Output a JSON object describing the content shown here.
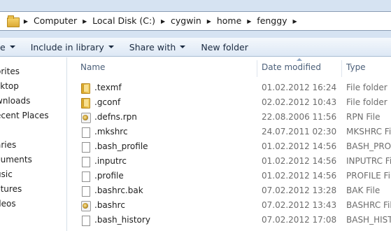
{
  "address_bar": {
    "crumbs": [
      "Computer",
      "Local Disk (C:)",
      "cygwin",
      "home",
      "fenggy"
    ],
    "separator_icon": "triangle-right-icon",
    "folder_icon": "folder-icon"
  },
  "toolbar": {
    "organize_partial": "e",
    "include_in_library": "Include in library",
    "share_with": "Share with",
    "new_folder": "New folder"
  },
  "nav": {
    "items": [
      "orites",
      "sktop",
      "wnloads",
      "ecent Places",
      "aries",
      "cuments",
      "usic",
      "ctures",
      "deos"
    ]
  },
  "columns": {
    "name": "Name",
    "date_modified": "Date modified",
    "type": "Type"
  },
  "files": [
    {
      "name": ".texmf",
      "date": "01.02.2012 16:24",
      "type": "File folder",
      "icon": "folder-icon"
    },
    {
      "name": ".gconf",
      "date": "02.02.2012 10:43",
      "type": "File folder",
      "icon": "folder-icon"
    },
    {
      "name": ".defns.rpn",
      "date": "22.08.2006 11:56",
      "type": "RPN File",
      "icon": "app-file-icon"
    },
    {
      "name": ".mkshrc",
      "date": "24.07.2011 02:30",
      "type": "MKSHRC File",
      "icon": "file-icon"
    },
    {
      "name": ".bash_profile",
      "date": "01.02.2012 14:56",
      "type": "BASH_PROFILE",
      "icon": "file-icon"
    },
    {
      "name": ".inputrc",
      "date": "01.02.2012 14:56",
      "type": "INPUTRC File",
      "icon": "file-icon"
    },
    {
      "name": ".profile",
      "date": "01.02.2012 14:56",
      "type": "PROFILE File",
      "icon": "file-icon"
    },
    {
      "name": ".bashrc.bak",
      "date": "07.02.2012 13:28",
      "type": "BAK File",
      "icon": "file-icon"
    },
    {
      "name": ".bashrc",
      "date": "07.02.2012 13:43",
      "type": "BASHRC File",
      "icon": "app-file-icon"
    },
    {
      "name": ".bash_history",
      "date": "07.02.2012 17:08",
      "type": "BASH_HISTORY",
      "icon": "file-icon"
    }
  ]
}
